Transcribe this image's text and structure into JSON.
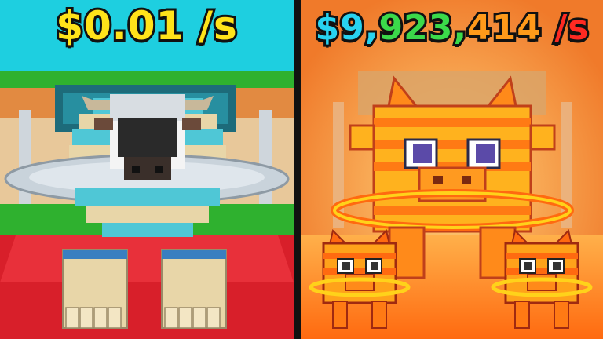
{
  "thumbnail": {
    "left": {
      "rate_text": "$0.01 /s",
      "colors": {
        "sky": "#1ecfe0",
        "floor": "#d81f2a",
        "grass": "#2fb12f",
        "text": "#ffe31a"
      }
    },
    "right": {
      "rate_text_parts": [
        {
          "text": "$9,",
          "color": "#28d3f0"
        },
        {
          "text": "923,",
          "color": "#3bd94a"
        },
        {
          "text": "414",
          "color": "#ff9a1a"
        },
        {
          "text": " /s",
          "color": "#ff2a22"
        }
      ],
      "colors": {
        "sky": "#f28a3a",
        "floor": "#ff7a10",
        "glow": "#ffd27a"
      }
    }
  }
}
